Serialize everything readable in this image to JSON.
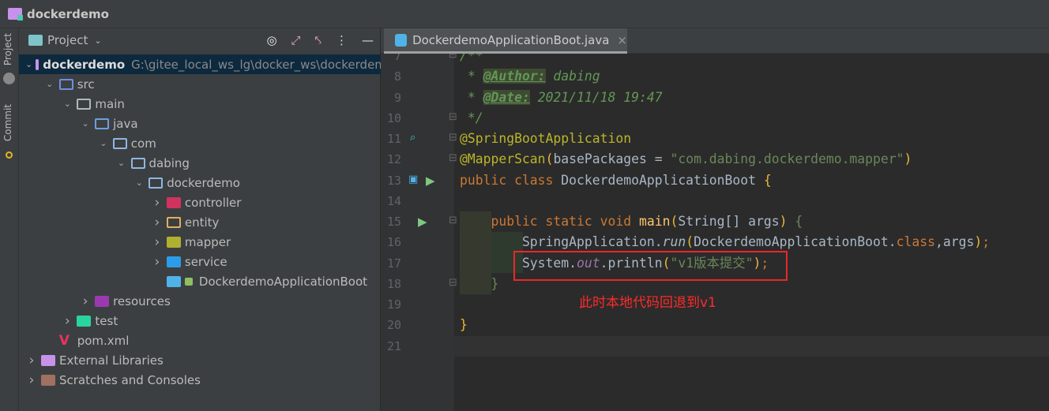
{
  "window": {
    "title": "dockerdemo"
  },
  "sidebar_tabs": [
    {
      "label": "Project"
    },
    {
      "label": "Commit"
    }
  ],
  "project_panel": {
    "title": "Project",
    "tools": [
      "locate-icon",
      "expand-all-icon",
      "collapse-all-icon",
      "more-icon",
      "hide-icon"
    ],
    "tree": [
      {
        "label": "dockerdemo",
        "path": "G:\\gitee_local_ws_lg\\docker_ws\\dockerdemo",
        "depth": 0,
        "expanded": true,
        "icon": "module-folder",
        "selected": true
      },
      {
        "label": "src",
        "depth": 1,
        "expanded": true,
        "icon": "source-folder"
      },
      {
        "label": "main",
        "depth": 2,
        "expanded": true,
        "icon": "folder"
      },
      {
        "label": "java",
        "depth": 3,
        "expanded": true,
        "icon": "source-root"
      },
      {
        "label": "com",
        "depth": 4,
        "expanded": true,
        "icon": "package"
      },
      {
        "label": "dabing",
        "depth": 5,
        "expanded": true,
        "icon": "package"
      },
      {
        "label": "dockerdemo",
        "depth": 6,
        "expanded": true,
        "icon": "package"
      },
      {
        "label": "controller",
        "depth": 7,
        "expanded": false,
        "icon": "controller-folder"
      },
      {
        "label": "entity",
        "depth": 7,
        "expanded": false,
        "icon": "entity-folder"
      },
      {
        "label": "mapper",
        "depth": 7,
        "expanded": false,
        "icon": "mapper-folder"
      },
      {
        "label": "service",
        "depth": 7,
        "expanded": false,
        "icon": "service-folder"
      },
      {
        "label": "DockerdemoApplicationBoot",
        "depth": 7,
        "expanded": null,
        "icon": "spring-boot-class"
      },
      {
        "label": "resources",
        "depth": 3,
        "expanded": false,
        "icon": "resources-folder"
      },
      {
        "label": "test",
        "depth": 2,
        "expanded": false,
        "icon": "test-folder"
      },
      {
        "label": "pom.xml",
        "depth": 1,
        "expanded": null,
        "icon": "maven-file"
      },
      {
        "label": "External Libraries",
        "depth": 0,
        "expanded": false,
        "icon": "libraries"
      },
      {
        "label": "Scratches and Consoles",
        "depth": 0,
        "expanded": false,
        "icon": "scratches"
      }
    ]
  },
  "editor": {
    "tab": {
      "label": "DockerdemoApplicationBoot.java"
    },
    "current_line": 21,
    "lines": [
      {
        "n": "7",
        "tokens": [
          {
            "t": "/**",
            "c": "cm"
          }
        ]
      },
      {
        "n": "8",
        "tokens": [
          {
            "t": " * ",
            "c": "cm"
          },
          {
            "t": "@Author:",
            "c": "tg"
          },
          {
            "t": " dabing",
            "c": "cm"
          }
        ]
      },
      {
        "n": "9",
        "tokens": [
          {
            "t": " * ",
            "c": "cm"
          },
          {
            "t": "@Date:",
            "c": "tg"
          },
          {
            "t": " 2021/11/18 19:47",
            "c": "cm"
          }
        ]
      },
      {
        "n": "10",
        "tokens": [
          {
            "t": " */",
            "c": "cm"
          }
        ]
      },
      {
        "n": "11",
        "tokens": [
          {
            "t": "@SpringBootApplication",
            "c": "an"
          }
        ]
      },
      {
        "n": "12",
        "tokens": [
          {
            "t": "@MapperScan",
            "c": "an"
          },
          {
            "t": "(",
            "c": "par"
          },
          {
            "t": "basePackages = ",
            "c": ""
          },
          {
            "t": "\"com.dabing.dockerdemo.mapper\"",
            "c": "st"
          },
          {
            "t": ")",
            "c": "par"
          }
        ]
      },
      {
        "n": "13",
        "tokens": [
          {
            "t": "public class ",
            "c": "kw"
          },
          {
            "t": "DockerdemoApplicationBoot ",
            "c": ""
          },
          {
            "t": "{",
            "c": "par"
          }
        ]
      },
      {
        "n": "14",
        "tokens": []
      },
      {
        "n": "15",
        "tokens": [
          {
            "t": "    public static void ",
            "c": "kw"
          },
          {
            "t": "main",
            "c": "fn"
          },
          {
            "t": "(",
            "c": "par"
          },
          {
            "t": "String[] args",
            "c": ""
          },
          {
            "t": ") ",
            "c": "par"
          },
          {
            "t": "{",
            "c": "st"
          }
        ]
      },
      {
        "n": "16",
        "tokens": [
          {
            "t": "        SpringApplication.",
            "c": ""
          },
          {
            "t": "run",
            "c": "it"
          },
          {
            "t": "(",
            "c": "par"
          },
          {
            "t": "DockerdemoApplicationBoot.",
            "c": ""
          },
          {
            "t": "class",
            "c": "kw"
          },
          {
            "t": ",args",
            "c": ""
          },
          {
            "t": ")",
            "c": "par"
          },
          {
            "t": ";",
            "c": "kw"
          }
        ]
      },
      {
        "n": "17",
        "tokens": [
          {
            "t": "        System.",
            "c": ""
          },
          {
            "t": "out",
            "c": "fld"
          },
          {
            "t": ".println",
            "c": ""
          },
          {
            "t": "(",
            "c": "par"
          },
          {
            "t": "\"v1版本提交\"",
            "c": "st"
          },
          {
            "t": ")",
            "c": "par"
          },
          {
            "t": ";",
            "c": "kw"
          }
        ]
      },
      {
        "n": "18",
        "tokens": [
          {
            "t": "    }",
            "c": "st"
          }
        ]
      },
      {
        "n": "19",
        "tokens": []
      },
      {
        "n": "20",
        "tokens": [
          {
            "t": "}",
            "c": "par"
          }
        ]
      },
      {
        "n": "21",
        "tokens": []
      }
    ],
    "annotation": "此时本地代码回退到v1",
    "highlight_color": "#e8282a"
  }
}
